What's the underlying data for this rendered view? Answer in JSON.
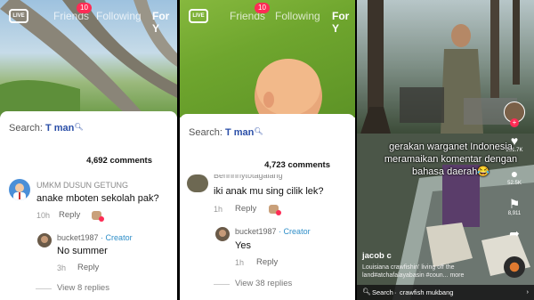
{
  "nav": {
    "live": "LIVE",
    "friends": "Friends",
    "friends_badge": "10",
    "following": "Following",
    "for_you": "For Y",
    "for_you_short": "For Y"
  },
  "panel1": {
    "search_prefix": "Search:",
    "search_term": "T man",
    "comment_count": "4,692 comments",
    "comments": [
      {
        "user": "UMKM DUSUN GETUNG",
        "text": "anake mboten sekolah pak?",
        "time": "10h",
        "reply": "Reply"
      },
      {
        "user": "bucket1987",
        "creator_label": "· Creator",
        "text": "No summer",
        "time": "3h",
        "reply": "Reply"
      }
    ],
    "view_replies": "View 8 replies"
  },
  "panel2": {
    "search_prefix": "Search:",
    "search_term": "T man",
    "comment_count": "4,723 comments",
    "comments": [
      {
        "user": "Behhhhytotagalang",
        "text": "iki anak mu sing cilik lek?",
        "time": "1h",
        "reply": "Reply"
      },
      {
        "user": "bucket1987",
        "creator_label": "· Creator",
        "text": "Yes",
        "time": "1h",
        "reply": "Reply"
      }
    ],
    "view_replies": "View 38 replies"
  },
  "panel3": {
    "caption": "gerakan warganet Indonesia meramaikan komentar dengan bahasa daerah😂",
    "author": "jacob c",
    "description": "Louisiana crawfishin' living off the land#atchafalayabasin #coun...   more",
    "likes": "231.7K",
    "comments": "52.5K",
    "saves": "8,911",
    "search_label": "Search",
    "search_query": "crawfish mukbang"
  },
  "icons": [
    "live-icon",
    "search-icon",
    "heart-icon",
    "comment-icon",
    "bookmark-icon",
    "share-icon",
    "music-disc-icon",
    "chevron-right-icon"
  ],
  "colors": {
    "tiktok_red": "#fe2c55",
    "creator_blue": "#2e8ec8",
    "search_blue": "#2b4fa8"
  }
}
